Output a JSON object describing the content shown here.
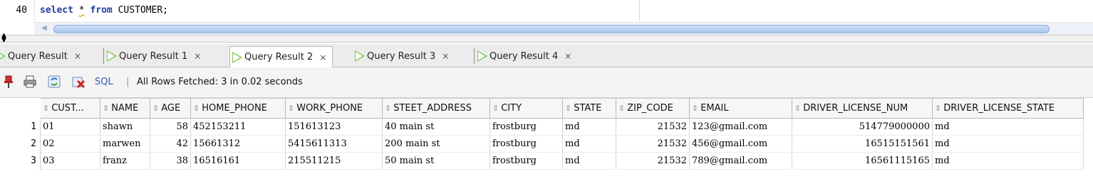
{
  "editor": {
    "line_number": "40",
    "code": {
      "kw_select": "select",
      "star": "*",
      "kw_from": "from",
      "rest": " CUSTOMER;"
    }
  },
  "tabs": [
    {
      "label": "Query Result",
      "active": false
    },
    {
      "label": "Query Result 1",
      "active": false
    },
    {
      "label": "Query Result 2",
      "active": true
    },
    {
      "label": "Query Result 3",
      "active": false
    },
    {
      "label": "Query Result 4",
      "active": false
    }
  ],
  "tab_close_glyph": "×",
  "toolbar": {
    "icons": [
      "pin-icon",
      "print-icon",
      "refresh-icon",
      "export-icon"
    ],
    "sql_label": "SQL",
    "separator": "|",
    "status": "All Rows Fetched: 3 in 0.02 seconds"
  },
  "grid": {
    "columns": [
      "CUST...",
      "NAME",
      "AGE",
      "HOME_PHONE",
      "WORK_PHONE",
      "STEET_ADDRESS",
      "CITY",
      "STATE",
      "ZIP_CODE",
      "EMAIL",
      "DRIVER_LICENSE_NUM",
      "DRIVER_LICENSE_STATE"
    ],
    "rows": [
      {
        "num": "1",
        "cells": [
          "01",
          "shawn",
          "58",
          "452153211",
          "151613123",
          "40 main st",
          "frostburg",
          "md",
          "21532",
          "123@gmail.com",
          "514779000000",
          "md"
        ]
      },
      {
        "num": "2",
        "cells": [
          "02",
          "marwen",
          "42",
          "15661312",
          "5415611313",
          "200 main st",
          "frostburg",
          "md",
          "21532",
          "456@gmail.com",
          "16515151561",
          "md"
        ]
      },
      {
        "num": "3",
        "cells": [
          "03",
          "franz",
          "38",
          "16516161",
          "215511215",
          "50 main st",
          "frostburg",
          "md",
          "21532",
          "789@gmail.com",
          "16561115165",
          "md"
        ]
      }
    ]
  },
  "colors": {
    "keyword": "#1f3f9f",
    "play_icon": "#7ec850",
    "sql_link": "#2a5fc4"
  }
}
